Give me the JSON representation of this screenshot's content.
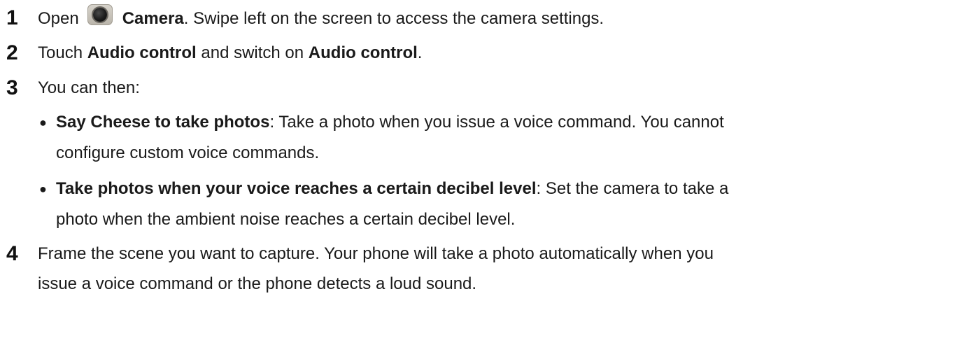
{
  "steps": [
    {
      "number": "1",
      "pre": "Open",
      "icon": "camera-app-icon",
      "b1": "Camera",
      "post": ". Swipe left on the screen to access the camera settings."
    },
    {
      "number": "2",
      "pre": "Touch ",
      "b1": "Audio control",
      "mid": " and switch on ",
      "b2": "Audio control",
      "post": "."
    },
    {
      "number": "3",
      "text": "You can then:",
      "bullets": [
        {
          "bold": "Say Cheese to take photos",
          "text_line1": ": Take a photo when you issue a voice command. You cannot",
          "text_line2": "configure custom voice commands."
        },
        {
          "bold": "Take photos when your voice reaches a certain decibel level",
          "text_line1": ": Set the camera to take a",
          "text_line2": "photo when the ambient noise reaches a certain decibel level."
        }
      ]
    },
    {
      "number": "4",
      "line1": "Frame the scene you want to capture. Your phone will take a photo automatically when you",
      "line2": "issue a voice command or the phone detects a loud sound."
    }
  ]
}
